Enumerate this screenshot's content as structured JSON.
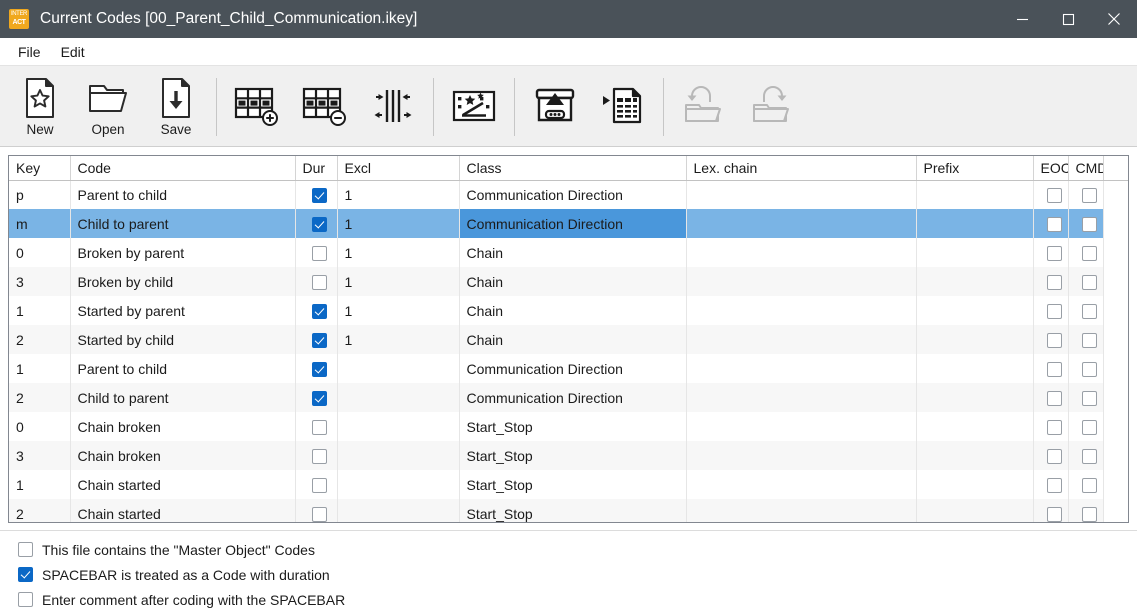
{
  "window": {
    "title": "Current Codes [00_Parent_Child_Communication.ikey]",
    "icon_top": "INTER",
    "icon_bottom": "ACT",
    "controls": {
      "minimize": "minimize-button",
      "maximize": "maximize-button",
      "close": "close-button"
    }
  },
  "menubar": {
    "items": [
      {
        "label": "File"
      },
      {
        "label": "Edit"
      }
    ]
  },
  "toolbar": {
    "buttons": [
      {
        "name": "new-button",
        "label": "New",
        "icon": "new-document-icon",
        "enabled": true
      },
      {
        "name": "open-button",
        "label": "Open",
        "icon": "open-folder-icon",
        "enabled": true
      },
      {
        "name": "save-button",
        "label": "Save",
        "icon": "save-document-icon",
        "enabled": true
      },
      {
        "name": "add-row-button",
        "label": "",
        "icon": "grid-add-icon",
        "enabled": true
      },
      {
        "name": "delete-row-button",
        "label": "",
        "icon": "grid-remove-icon",
        "enabled": true
      },
      {
        "name": "adjust-columns-button",
        "label": "",
        "icon": "column-resize-icon",
        "enabled": true
      },
      {
        "name": "auto-generate-button",
        "label": "",
        "icon": "magic-wand-grid-icon",
        "enabled": true
      },
      {
        "name": "import-button",
        "label": "",
        "icon": "import-archive-icon",
        "enabled": true
      },
      {
        "name": "export-button",
        "label": "",
        "icon": "export-spreadsheet-icon",
        "enabled": true
      },
      {
        "name": "undo-folder-button",
        "label": "",
        "icon": "undo-folder-icon",
        "enabled": false
      },
      {
        "name": "redo-folder-button",
        "label": "",
        "icon": "redo-folder-icon",
        "enabled": false
      }
    ]
  },
  "table": {
    "columns": [
      {
        "key": "key",
        "label": "Key"
      },
      {
        "key": "code",
        "label": "Code"
      },
      {
        "key": "dur",
        "label": "Dur"
      },
      {
        "key": "excl",
        "label": "Excl"
      },
      {
        "key": "class",
        "label": "Class"
      },
      {
        "key": "lex_chain",
        "label": "Lex. chain"
      },
      {
        "key": "prefix",
        "label": "Prefix"
      },
      {
        "key": "eoc",
        "label": "EOC"
      },
      {
        "key": "cmd",
        "label": "CMD"
      },
      {
        "key": "filler",
        "label": ""
      }
    ],
    "rows": [
      {
        "key": "p",
        "code": "Parent to child",
        "dur": true,
        "excl": "1",
        "class": "Communication Direction",
        "lex_chain": "",
        "prefix": "",
        "eoc": false,
        "cmd": false,
        "selected": false
      },
      {
        "key": "m",
        "code": "Child to parent",
        "dur": true,
        "excl": "1",
        "class": "Communication Direction",
        "lex_chain": "",
        "prefix": "",
        "eoc": false,
        "cmd": false,
        "selected": true
      },
      {
        "key": "0",
        "code": "Broken by parent",
        "dur": false,
        "excl": "1",
        "class": "Chain",
        "lex_chain": "",
        "prefix": "",
        "eoc": false,
        "cmd": false,
        "selected": false
      },
      {
        "key": "3",
        "code": "Broken by child",
        "dur": false,
        "excl": "1",
        "class": "Chain",
        "lex_chain": "",
        "prefix": "",
        "eoc": false,
        "cmd": false,
        "selected": false
      },
      {
        "key": "1",
        "code": "Started by parent",
        "dur": true,
        "excl": "1",
        "class": "Chain",
        "lex_chain": "",
        "prefix": "",
        "eoc": false,
        "cmd": false,
        "selected": false
      },
      {
        "key": "2",
        "code": "Started by child",
        "dur": true,
        "excl": "1",
        "class": "Chain",
        "lex_chain": "",
        "prefix": "",
        "eoc": false,
        "cmd": false,
        "selected": false
      },
      {
        "key": "1",
        "code": "Parent to child",
        "dur": true,
        "excl": "",
        "class": "Communication Direction",
        "lex_chain": "",
        "prefix": "",
        "eoc": false,
        "cmd": false,
        "selected": false
      },
      {
        "key": "2",
        "code": "Child to parent",
        "dur": true,
        "excl": "",
        "class": "Communication Direction",
        "lex_chain": "",
        "prefix": "",
        "eoc": false,
        "cmd": false,
        "selected": false
      },
      {
        "key": "0",
        "code": "Chain broken",
        "dur": false,
        "excl": "",
        "class": "Start_Stop",
        "lex_chain": "",
        "prefix": "",
        "eoc": false,
        "cmd": false,
        "selected": false
      },
      {
        "key": "3",
        "code": "Chain broken",
        "dur": false,
        "excl": "",
        "class": "Start_Stop",
        "lex_chain": "",
        "prefix": "",
        "eoc": false,
        "cmd": false,
        "selected": false
      },
      {
        "key": "1",
        "code": "Chain started",
        "dur": false,
        "excl": "",
        "class": "Start_Stop",
        "lex_chain": "",
        "prefix": "",
        "eoc": false,
        "cmd": false,
        "selected": false
      },
      {
        "key": "2",
        "code": "Chain started",
        "dur": false,
        "excl": "",
        "class": "Start_Stop",
        "lex_chain": "",
        "prefix": "",
        "eoc": false,
        "cmd": false,
        "selected": false
      }
    ]
  },
  "options": [
    {
      "name": "master-object-codes-checkbox",
      "label": "This file contains the \"Master Object\" Codes",
      "checked": false
    },
    {
      "name": "spacebar-duration-checkbox",
      "label": "SPACEBAR is treated as a Code with duration",
      "checked": true
    },
    {
      "name": "comment-after-spacebar-checkbox",
      "label": "Enter comment after coding with the SPACEBAR",
      "checked": false
    }
  ],
  "colors": {
    "titlebar": "#4a5259",
    "accent_icon": "#f0a81e",
    "selection": "#7ab4e5",
    "selection_focus": "#4a97db",
    "checkbox_checked": "#0b68c6",
    "toolbar_bg": "#f0f0f0"
  }
}
